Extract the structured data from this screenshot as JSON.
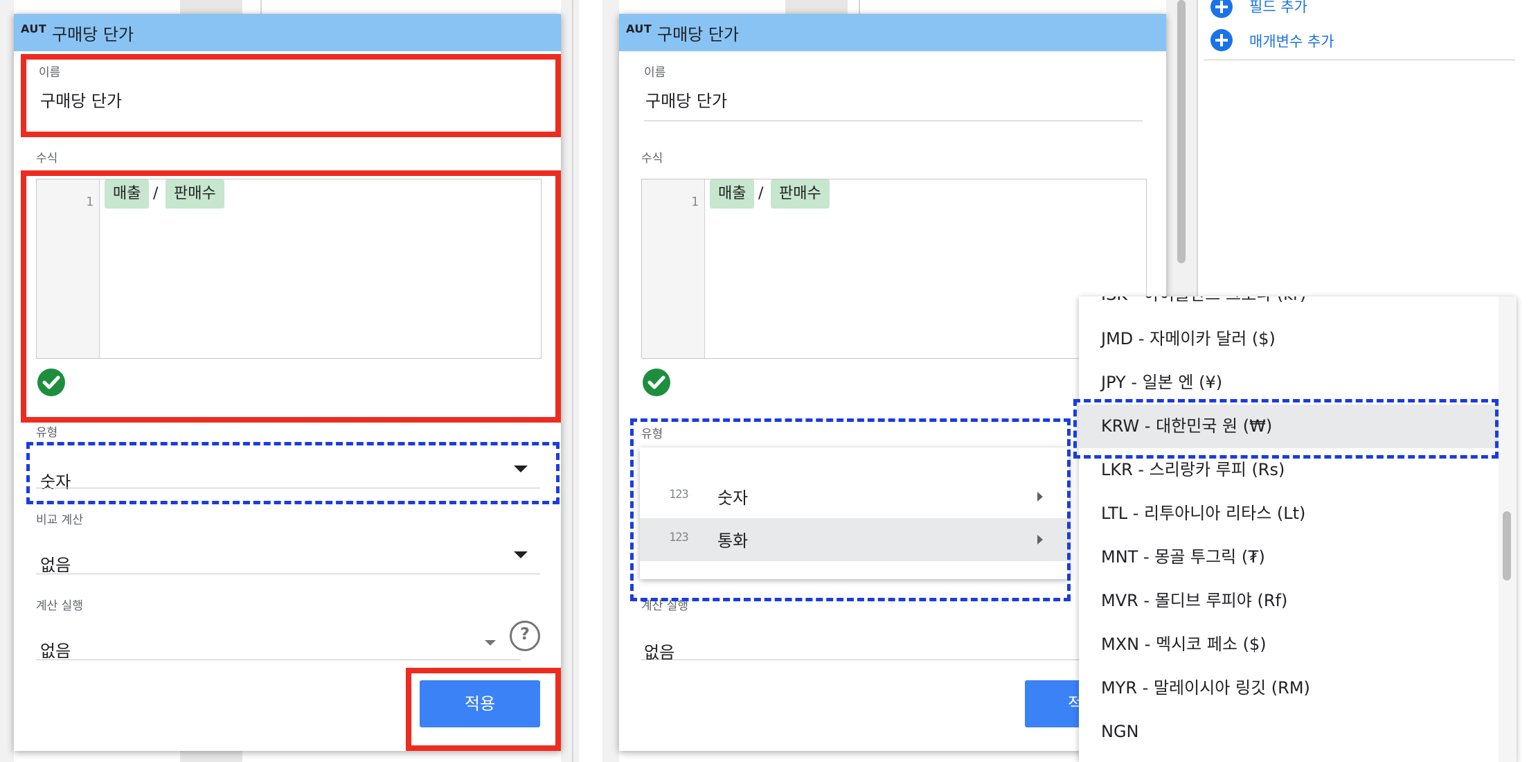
{
  "left_panel": {
    "dialog": {
      "header_icon": "AUT",
      "title": "구매당 단가",
      "name_label": "이름",
      "name_value": "구매당 단가",
      "formula_label": "수식",
      "formula_line_number": "1",
      "formula_chip_1": "매출",
      "formula_operator": "/",
      "formula_chip_2": "판매수",
      "type_label": "유형",
      "type_value": "숫자",
      "comparison_label": "비교 계산",
      "comparison_value": "없음",
      "running_calc_label": "계산 실행",
      "running_calc_value": "없음",
      "help_symbol": "?",
      "apply_label": "적용"
    }
  },
  "right_panel": {
    "side_links": {
      "add_field": "필드 추가",
      "add_parameter": "매개변수 추가"
    },
    "dialog": {
      "header_icon": "AUT",
      "title": "구매당 단가",
      "name_label": "이름",
      "name_value": "구매당 단가",
      "formula_label": "수식",
      "formula_line_number": "1",
      "formula_chip_1": "매출",
      "formula_operator": "/",
      "formula_chip_2": "판매수",
      "type_label": "유형",
      "running_calc_label": "계산 실행",
      "running_calc_value": "없음",
      "apply_label_partial": "적"
    },
    "type_menu": {
      "items": [
        {
          "icon_text": "123",
          "label": "숫자"
        },
        {
          "icon_text": "123",
          "label": "통화"
        }
      ]
    },
    "currency_list": {
      "items": [
        "ISK - 아이슬란드 크로나 (kr)",
        "JMD - 자메이카 달러 ($)",
        "JPY - 일본 엔 (¥)",
        "KRW - 대한민국 원 (₩)",
        "LKR - 스리랑카 루피 (Rs)",
        "LTL - 리투아니아 리타스 (Lt)",
        "MNT - 몽골 투그릭 (₮)",
        "MVR - 몰디브 루피야 (Rf)",
        "MXN - 멕시코 페소 ($)",
        "MYR - 말레이시아 링깃 (RM)",
        "NGN"
      ],
      "selected": "KRW - 대한민국 원 (₩)"
    }
  },
  "colors": {
    "header_blue": "#88c3f4",
    "chip_green": "#c6e6cd",
    "check_green": "#1e8e3e",
    "apply_blue": "#3b82f6",
    "annotation_red": "#ee2b1f",
    "annotation_blue": "#1a3de0",
    "link_blue": "#1a73e8"
  }
}
